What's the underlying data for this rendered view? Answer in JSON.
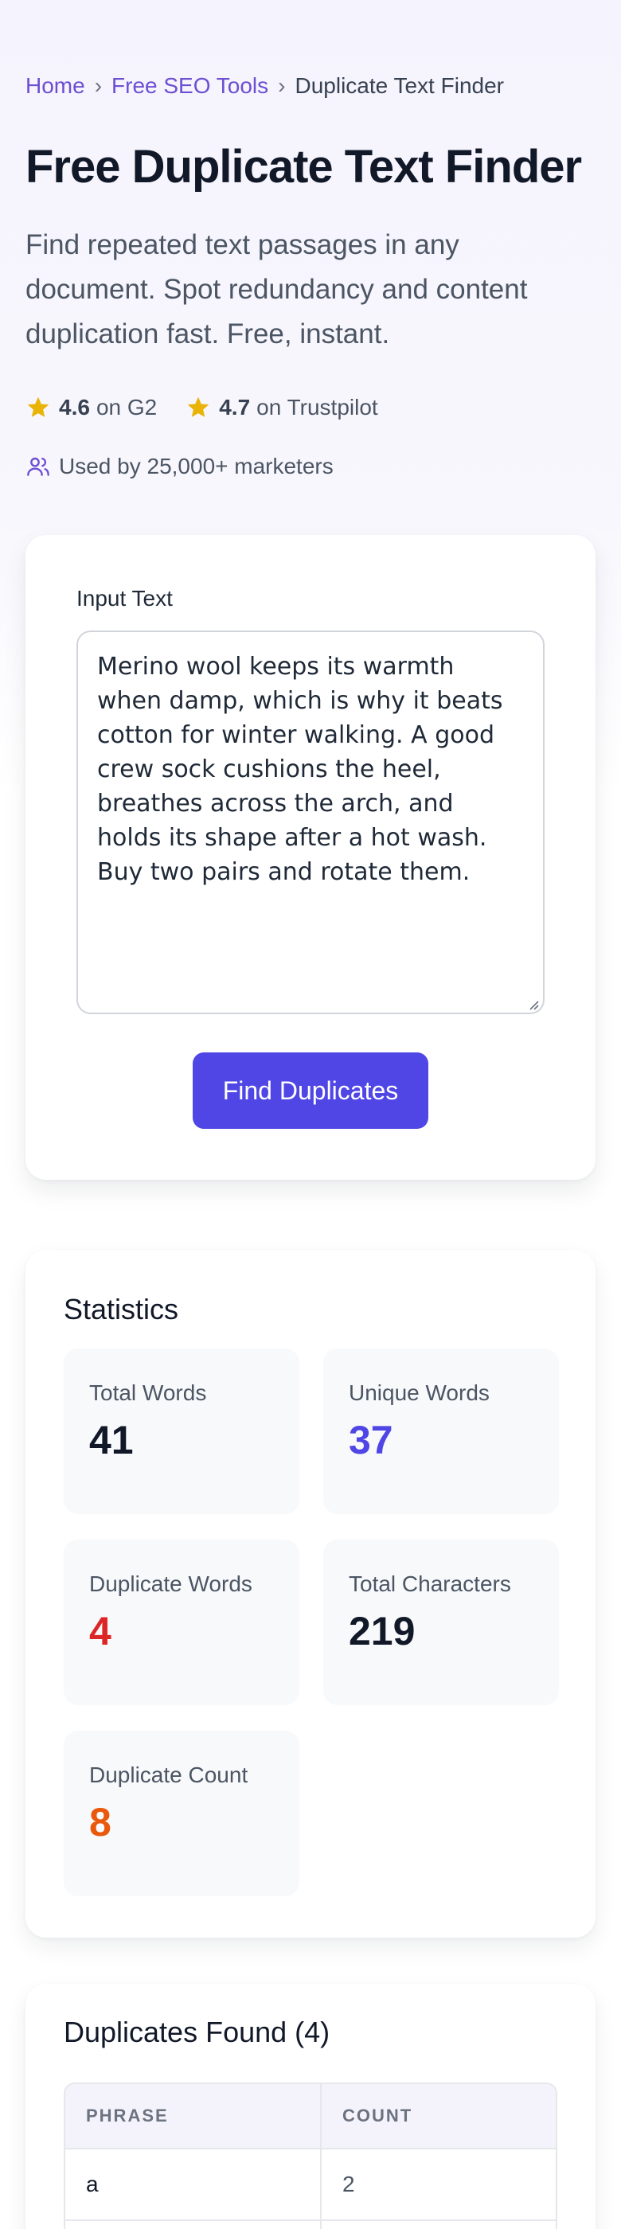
{
  "breadcrumb": {
    "home": "Home",
    "sep1": "›",
    "tools": "Free SEO Tools",
    "sep2": "›",
    "current": "Duplicate Text Finder"
  },
  "hero": {
    "title": "Free Duplicate Text Finder",
    "subtitle": "Find repeated text passages in any document. Spot redundancy and content duplication fast. Free, instant."
  },
  "ratings": [
    {
      "score": "4.6",
      "source": "on G2",
      "icon": "star-icon"
    },
    {
      "score": "4.7",
      "source": "on Trustpilot",
      "icon": "star-icon"
    }
  ],
  "users": {
    "icon": "users-icon",
    "text": "Used by 25,000+ marketers"
  },
  "input": {
    "label": "Input Text",
    "value": "Merino wool keeps its warmth when damp, which is why it beats cotton for winter walking. A good crew sock cushions the heel, breathes across the arch, and holds its shape after a hot wash. Buy two pairs and rotate them.",
    "button": "Find Duplicates"
  },
  "statistics": {
    "title": "Statistics",
    "items": [
      {
        "label": "Total Words",
        "value": "41",
        "color": "#111827"
      },
      {
        "label": "Unique Words",
        "value": "37",
        "color": "#4f46e5"
      },
      {
        "label": "Duplicate Words",
        "value": "4",
        "color": "#dc2626"
      },
      {
        "label": "Total Characters",
        "value": "219",
        "color": "#111827"
      },
      {
        "label": "Duplicate Count",
        "value": "8",
        "color": "#ea580c"
      }
    ]
  },
  "duplicates": {
    "title": "Duplicates Found (4)",
    "columns": [
      "PHRASE",
      "COUNT"
    ],
    "rows": [
      {
        "phrase": "a",
        "count": "2"
      }
    ]
  },
  "colors": {
    "accent": "#4f46e5",
    "link": "#6d4fd2",
    "star": "#eab308"
  }
}
